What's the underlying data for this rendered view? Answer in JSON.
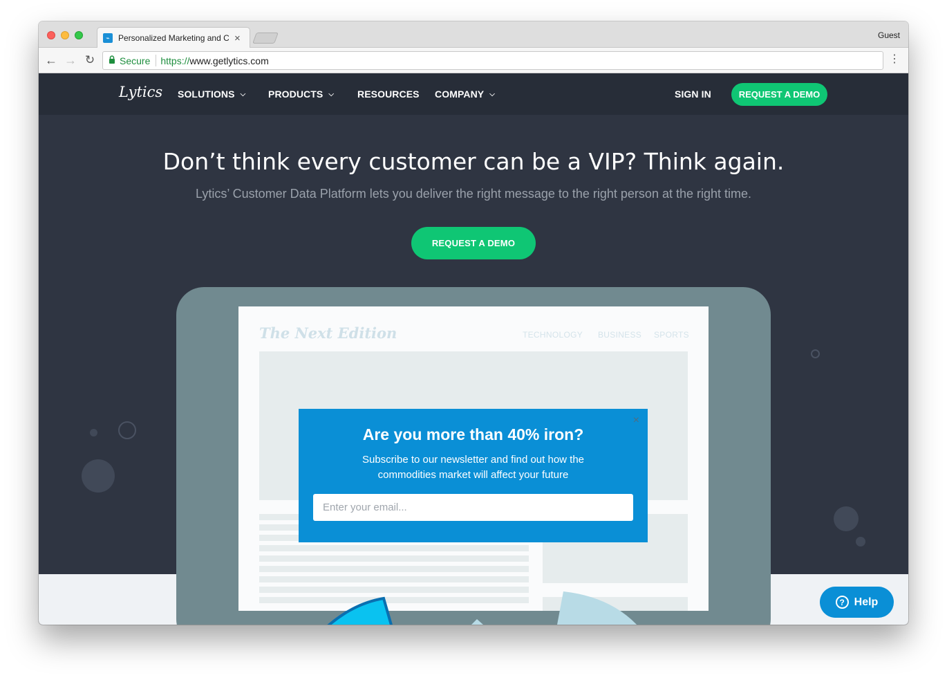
{
  "browser": {
    "tab_title": "Personalized Marketing and Cu",
    "tab_close": "×",
    "profile": "Guest",
    "secure_label": "Secure",
    "url_scheme": "https://",
    "url_host": "www.getlytics.com",
    "back_icon": "←",
    "forward_icon": "→",
    "reload_icon": "↻",
    "menu_icon": "⋮"
  },
  "site_nav": {
    "logo": "Lytics",
    "items": [
      {
        "label": "SOLUTIONS",
        "caret": "⌄"
      },
      {
        "label": "PRODUCTS",
        "caret": "⌄"
      },
      {
        "label": "RESOURCES"
      },
      {
        "label": "COMPANY",
        "caret": "⌄"
      }
    ],
    "sign_in": "SIGN IN",
    "cta": "REQUEST A DEMO"
  },
  "hero": {
    "title": "Don’t think every customer can be a VIP? Think again.",
    "subtitle": "Lytics’ Customer Data Platform lets you deliver the right message to the right person at the right time.",
    "cta": "REQUEST A DEMO"
  },
  "mockup": {
    "brand": "The Next Edition",
    "links": [
      "TECHNOLOGY",
      "BUSINESS",
      "SPORTS"
    ]
  },
  "modal": {
    "close": "×",
    "title": "Are you more than 40% iron?",
    "subtitle": "Subscribe to our newsletter and find out how the commodities market will affect your future",
    "email_placeholder": "Enter your email...",
    "email_value": ""
  },
  "help": {
    "icon": "?",
    "label": "Help"
  },
  "colors": {
    "page_bg": "#2f3542",
    "nav_bg": "#272d38",
    "accent_green": "#0fc674",
    "accent_blue": "#0a8fd6"
  }
}
